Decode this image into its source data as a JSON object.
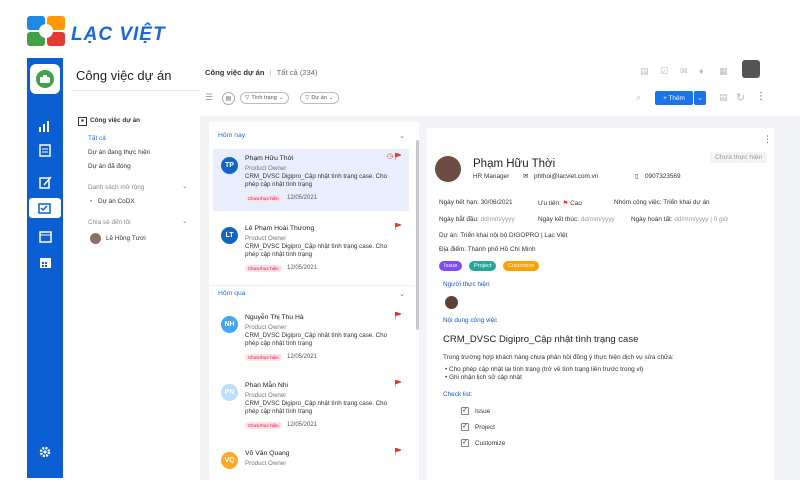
{
  "brand": {
    "name": "LẠC VIỆT"
  },
  "sidebar": {
    "title": "Công việc dự án",
    "section": "Công việc dự án",
    "items": [
      "Tất cả",
      "Dự án đang thực hiện",
      "Dự án đã đóng"
    ],
    "expand_header": "Danh sách mở rộng",
    "expand_items": [
      "Dự án CoDX"
    ],
    "shared_header": "Chia sẻ đến tôi",
    "shared_items": [
      "Lê Hồng Tươi"
    ]
  },
  "header": {
    "breadcrumb": "Công việc dự án",
    "separator": "|",
    "count_label": "Tất cả (234)",
    "filters": [
      "Tình trạng",
      "Dự án"
    ],
    "add_label": "+ Thêm"
  },
  "list": {
    "groups": [
      {
        "label": "Hôm nay",
        "cards": [
          {
            "initials": "TP",
            "color": "#1565c0",
            "name": "Phạm Hữu Thời",
            "role": "Product Owner",
            "desc": "CRM_DVSC Digipro_Cập nhật tình trạng case. Cho phép cập nhật tình trạng",
            "status": "Chưa thực hiện",
            "date": "12/05/2021",
            "selected": true
          },
          {
            "initials": "LT",
            "color": "#1565c0",
            "name": "Lê Phạm Hoài Thương",
            "role": "Product Owner",
            "desc": "CRM_DVSC Digipro_Cập nhật tình trạng case. Cho phép cập nhật tình trạng",
            "status": "Chưa thực hiện",
            "date": "12/05/2021"
          }
        ]
      },
      {
        "label": "Hôm qua",
        "cards": [
          {
            "initials": "NH",
            "color": "#42a5f5",
            "name": "Nguyễn Thị Thu Hà",
            "role": "Product Owner",
            "desc": "CRM_DVSC Digipro_Cập nhật tình trạng case. Cho phép cập nhật tình trạng",
            "status": "Chưa thực hiện",
            "date": "12/05/2021"
          },
          {
            "initials": "PN",
            "color": "#bbdefb",
            "name": "Phan Mẫn Nhi",
            "role": "Product Owner",
            "desc": "CRM_DVSC Digipro_Cập nhật tình trạng case. Cho phép cập nhật tình trạng",
            "status": "Chưa thực hiện",
            "date": "12/05/2021"
          },
          {
            "initials": "VQ",
            "color": "#ffa726",
            "name": "Võ Văn Quang",
            "role": "Product Owner",
            "desc": "",
            "status": "",
            "date": ""
          }
        ]
      }
    ]
  },
  "detail": {
    "status_badge": "Chưa thực hiện",
    "name": "Phạm Hữu Thời",
    "position": "HR Manager",
    "email": "phthoi@lacviet.com.vn",
    "phone": "0907323569",
    "due_label": "Ngày hết hạn:",
    "due": "30/06/2021",
    "priority_label": "Ưu tiên:",
    "priority": "Cao",
    "group_label": "Nhóm công việc:",
    "group": "Triển khai dự án",
    "start_label": "Ngày bắt đầu:",
    "start": "dd/mm/yyyy",
    "end_label": "Ngày kết thúc:",
    "end": "dd/mm/yyyy",
    "done_label": "Ngày hoàn tất:",
    "done": "dd/mm/yyyy | 0 giờ",
    "project_label": "Dự án:",
    "project": "Triển khai nội bộ DIGOPRO | Lạc Việt",
    "place_label": "Địa điểm:",
    "place": "Thành phố Hồ Chí Minh",
    "tags": [
      {
        "label": "Issue",
        "color": "#7c4dff"
      },
      {
        "label": "Project",
        "color": "#26a69a"
      },
      {
        "label": "Customize",
        "color": "#ffa000"
      }
    ],
    "assignee_header": "Người thực hiện",
    "content_header": "Nội dung công việc",
    "task_title": "CRM_DVSC Digipro_Cập nhật tình trạng case",
    "task_intro": "Trong trường hợp khách hàng chưa phản hồi đồng ý thực hiện dịch vụ sửa chữa:",
    "bullets": [
      "Cho phép cập nhật lại tình trạng (trở về tình trạng liền trước trong vl)",
      "Ghi nhận lịch sử cập nhật"
    ],
    "checklist_header": "Check list:",
    "checklist": [
      "Issue",
      "Project",
      "Customize"
    ]
  }
}
